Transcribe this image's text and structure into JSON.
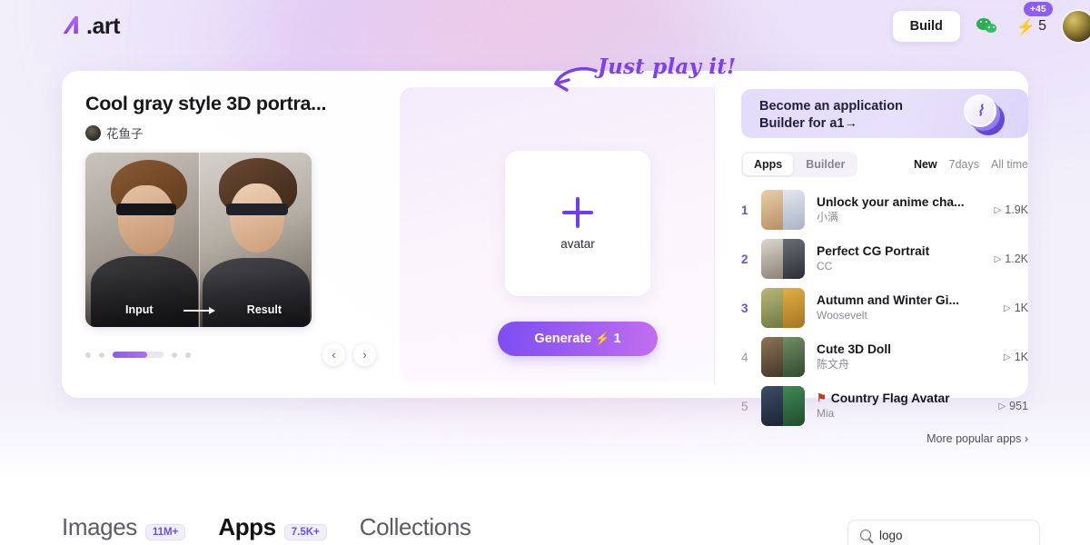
{
  "header": {
    "logo_text": ".art",
    "build_label": "Build",
    "wechat_icon": "wechat-icon",
    "energy_icon": "lightning-bolt-icon",
    "energy_count": "5",
    "bonus_badge": "+45",
    "avatar": "user-avatar"
  },
  "app_card": {
    "title": "Cool gray style 3D portra...",
    "author": "花鱼子",
    "preview": {
      "input_label": "Input",
      "result_label": "Result",
      "arrow_icon": "arrow-right-icon"
    },
    "pager": {
      "prev_icon": "‹",
      "next_icon": "›"
    }
  },
  "workspace": {
    "upload_plus_icon": "plus-icon",
    "upload_label": "avatar",
    "generate_label": "Generate",
    "generate_bolt": "⚡",
    "generate_cost": "1"
  },
  "annotation": {
    "text": "Just play it!",
    "arrow_icon": "curved-arrow-left-icon"
  },
  "right_panel": {
    "banner": {
      "line1": "Become an application",
      "line2": "Builder for a1→",
      "coin_icon": "coin-stack-icon"
    },
    "tabs": [
      {
        "label": "Apps",
        "active": true
      },
      {
        "label": "Builder",
        "active": false
      }
    ],
    "filters": [
      {
        "label": "New",
        "active": true
      },
      {
        "label": "7days",
        "active": false
      },
      {
        "label": "All time",
        "active": false
      }
    ],
    "ranks": [
      {
        "rank": "1",
        "title": "Unlock your anime cha...",
        "author": "小满",
        "plays": "1.9K",
        "flag": "",
        "c1": "#d8c0a8",
        "c2": "#cfd6e0"
      },
      {
        "rank": "2",
        "title": "Perfect CG Portrait",
        "author": "CC",
        "plays": "1.2K",
        "flag": "",
        "c1": "#c8c4bd",
        "c2": "#54565c"
      },
      {
        "rank": "3",
        "title": "Autumn and Winter Gi...",
        "author": "Woosevelt",
        "plays": "1K",
        "flag": "",
        "c1": "#9aa05c",
        "c2": "#d8a33c"
      },
      {
        "rank": "4",
        "title": "Cute 3D Doll",
        "author": "陈文舟",
        "plays": "1K",
        "flag": "",
        "c1": "#6b5c45",
        "c2": "#4e6b4a"
      },
      {
        "rank": "5",
        "title": "Country Flag Avatar",
        "author": "Mia",
        "plays": "951",
        "flag": "⚑",
        "c1": "#2d3a52",
        "c2": "#2f6b43"
      }
    ],
    "more_label": "More popular apps ›",
    "play_icon": "play-icon"
  },
  "bottom_nav": {
    "items": [
      {
        "label": "Images",
        "badge": "11M+",
        "active": false
      },
      {
        "label": "Apps",
        "badge": "7.5K+",
        "active": true
      },
      {
        "label": "Collections",
        "badge": "",
        "active": false
      }
    ],
    "search": {
      "icon": "search-icon",
      "value": "logo"
    }
  },
  "colors": {
    "accent_purple": "#7c4ef2",
    "accent_violet": "#6a4bf0",
    "badge_purple": "#8b5cf6",
    "wechat_green": "#2aae52",
    "background": "#f3f0fb"
  }
}
